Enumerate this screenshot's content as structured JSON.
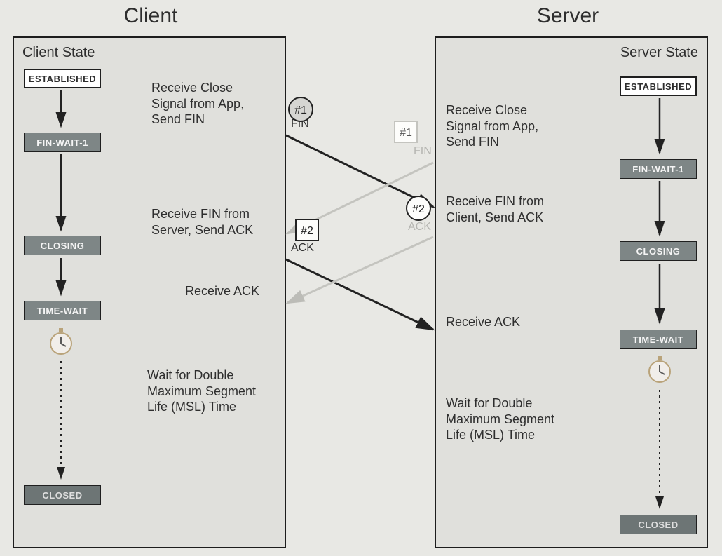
{
  "titles": {
    "client": "Client",
    "server": "Server"
  },
  "headings": {
    "client": "Client State",
    "server": "Server State"
  },
  "states": {
    "established": "ESTABLISHED",
    "finwait1": "FIN-WAIT-1",
    "closing": "CLOSING",
    "timewait": "TIME-WAIT",
    "closed": "CLOSED"
  },
  "notes": {
    "cl_sendfin": "Receive Close\nSignal from App,\nSend FIN",
    "cl_recvfin": "Receive FIN from\nServer, Send ACK",
    "cl_recvack": "Receive ACK",
    "cl_wait": "Wait for Double\nMaximum Segment\nLife (MSL) Time",
    "sv_sendfin": "Receive Close\nSignal from App,\nSend FIN",
    "sv_recvfin": "Receive FIN from\nClient, Send ACK",
    "sv_recvack": "Receive ACK",
    "sv_wait": "Wait for Double\nMaximum Segment\nLife (MSL) Time"
  },
  "mid": {
    "c1_num": "#1",
    "c1_lab": "FIN",
    "c2_num": "#2",
    "c2_lab": "ACK",
    "s1_num": "#1",
    "s1_lab": "FIN",
    "s2_num": "#2",
    "s2_lab": "ACK"
  }
}
